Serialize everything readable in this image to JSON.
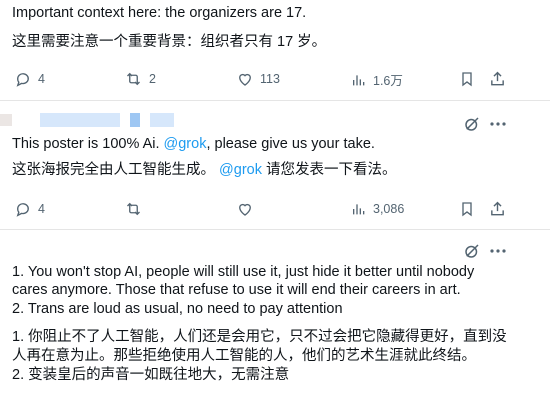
{
  "tweets": [
    {
      "text_en": "Important context here: the organizers are 17.",
      "text_zh": "这里需要注意一个重要背景：组织者只有 17 岁。",
      "replies": "4",
      "reposts": "2",
      "likes": "113",
      "views": "1.6万"
    },
    {
      "text_en_prefix": "This poster is 100% Ai. ",
      "text_en_mention": "@grok",
      "text_en_suffix": ", please give us your take.",
      "text_zh_prefix": "这张海报完全由人工智能生成。 ",
      "text_zh_mention": "@grok",
      "text_zh_suffix": " 请您发表一下看法。",
      "replies": "4",
      "reposts": "",
      "likes": "",
      "views": "3,086"
    },
    {
      "en_lines": [
        "1. You won't stop AI, people will still use it, just hide it better until nobody",
        "cares anymore. Those that refuse to use it will end their careers in art.",
        "2. Trans are loud as usual, no need to pay attention"
      ],
      "zh_lines": [
        "1. 你阻止不了人工智能，人们还是会用它，只不过会把它隐藏得更好，直到没",
        "人再在意为止。那些拒绝使用人工智能的人，他们的艺术生涯就此终结。",
        "2. 变装皇后的声音一如既往地大，无需注意"
      ]
    }
  ],
  "icons": {
    "reply": "reply-icon",
    "repost": "repost-icon",
    "like": "heart-icon",
    "views": "views-icon",
    "bookmark": "bookmark-icon",
    "share": "share-icon",
    "grok": "grok-icon",
    "more": "more-icon"
  },
  "colors": {
    "text": "#0f1419",
    "muted": "#536471",
    "link": "#1d9bf0",
    "divider": "#e5e5e5",
    "selection": "#d6e7fb"
  }
}
